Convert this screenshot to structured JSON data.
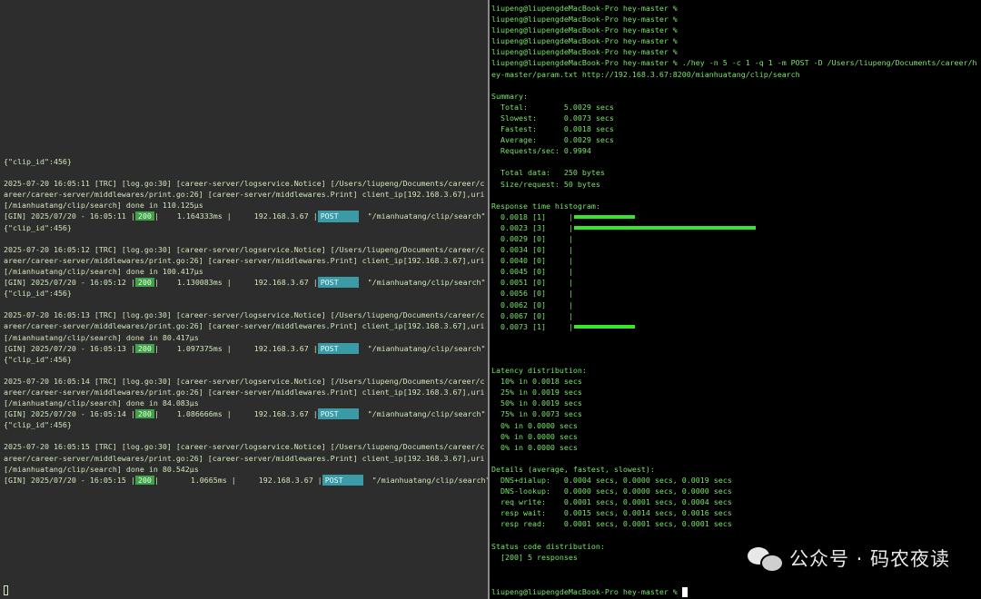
{
  "left_terminal": {
    "first_line": "{\"clip_id\":456}",
    "entries": [
      {
        "log1": "2025-07-20 16:05:11 [TRC] [log.go:30] [career-server/logservice.Notice] [/Users/liupeng/Documents/career/c",
        "log2": "areer/career-server/middlewares/print.go:26] [career-server/middlewares.Print] client_ip[192.168.3.67],uri",
        "log3": "[/mianhuatang/clip/search] done in 110.125µs",
        "gin_prefix": "[GIN] 2025/07/20 - 16:05:11 |",
        "status": "200",
        "mid": "|    1.164333ms |     192.168.3.67 |",
        "method": "POST",
        "path": "  \"/mianhuatang/clip/search\"",
        "body": "{\"clip_id\":456}"
      },
      {
        "log1": "2025-07-20 16:05:12 [TRC] [log.go:30] [career-server/logservice.Notice] [/Users/liupeng/Documents/career/c",
        "log2": "areer/career-server/middlewares/print.go:26] [career-server/middlewares.Print] client_ip[192.168.3.67],uri",
        "log3": "[/mianhuatang/clip/search] done in 100.417µs",
        "gin_prefix": "[GIN] 2025/07/20 - 16:05:12 |",
        "status": "200",
        "mid": "|    1.130083ms |     192.168.3.67 |",
        "method": "POST",
        "path": "  \"/mianhuatang/clip/search\"",
        "body": "{\"clip_id\":456}"
      },
      {
        "log1": "2025-07-20 16:05:13 [TRC] [log.go:30] [career-server/logservice.Notice] [/Users/liupeng/Documents/career/c",
        "log2": "areer/career-server/middlewares/print.go:26] [career-server/middlewares.Print] client_ip[192.168.3.67],uri",
        "log3": "[/mianhuatang/clip/search] done in 80.417µs",
        "gin_prefix": "[GIN] 2025/07/20 - 16:05:13 |",
        "status": "200",
        "mid": "|    1.097375ms |     192.168.3.67 |",
        "method": "POST",
        "path": "  \"/mianhuatang/clip/search\"",
        "body": "{\"clip_id\":456}"
      },
      {
        "log1": "2025-07-20 16:05:14 [TRC] [log.go:30] [career-server/logservice.Notice] [/Users/liupeng/Documents/career/c",
        "log2": "areer/career-server/middlewares/print.go:26] [career-server/middlewares.Print] client_ip[192.168.3.67],uri",
        "log3": "[/mianhuatang/clip/search] done in 84.083µs",
        "gin_prefix": "[GIN] 2025/07/20 - 16:05:14 |",
        "status": "200",
        "mid": "|    1.086666ms |     192.168.3.67 |",
        "method": "POST",
        "path": "  \"/mianhuatang/clip/search\"",
        "body": "{\"clip_id\":456}"
      },
      {
        "log1": "2025-07-20 16:05:15 [TRC] [log.go:30] [career-server/logservice.Notice] [/Users/liupeng/Documents/career/c",
        "log2": "areer/career-server/middlewares/print.go:26] [career-server/middlewares.Print] client_ip[192.168.3.67],uri",
        "log3": "[/mianhuatang/clip/search] done in 80.542µs",
        "gin_prefix": "[GIN] 2025/07/20 - 16:05:15 |",
        "status": "200",
        "mid": "|       1.0665ms |     192.168.3.67 |",
        "method": "POST",
        "path": "  \"/mianhuatang/clip/search\"",
        "body": ""
      }
    ],
    "cursor": ""
  },
  "right_terminal": {
    "prompts": [
      "liupeng@liupengdeMacBook-Pro hey-master %",
      "liupeng@liupengdeMacBook-Pro hey-master %",
      "liupeng@liupengdeMacBook-Pro hey-master %",
      "liupeng@liupengdeMacBook-Pro hey-master %",
      "liupeng@liupengdeMacBook-Pro hey-master %"
    ],
    "command_line1": "liupeng@liupengdeMacBook-Pro hey-master % ./hey -n 5 -c 1 -q 1 -m POST -D /Users/liupeng/Documents/career/h",
    "command_line2": "ey-master/param.txt http://192.168.3.67:8200/mianhuatang/clip/search",
    "summary_title": "Summary:",
    "summary": [
      "  Total:        5.0029 secs",
      "  Slowest:      0.0073 secs",
      "  Fastest:      0.0018 secs",
      "  Average:      0.0029 secs",
      "  Requests/sec: 0.9994"
    ],
    "data_lines": [
      "  Total data:   250 bytes",
      "  Size/request: 50 bytes"
    ],
    "histogram_title": "Response time histogram:",
    "histogram": [
      {
        "label": "  0.0018 [1]     |",
        "count": 1
      },
      {
        "label": "  0.0023 [3]     |",
        "count": 3
      },
      {
        "label": "  0.0029 [0]     |",
        "count": 0
      },
      {
        "label": "  0.0034 [0]     |",
        "count": 0
      },
      {
        "label": "  0.0040 [0]     |",
        "count": 0
      },
      {
        "label": "  0.0045 [0]     |",
        "count": 0
      },
      {
        "label": "  0.0051 [0]     |",
        "count": 0
      },
      {
        "label": "  0.0056 [0]     |",
        "count": 0
      },
      {
        "label": "  0.0062 [0]     |",
        "count": 0
      },
      {
        "label": "  0.0067 [0]     |",
        "count": 0
      },
      {
        "label": "  0.0073 [1]     |",
        "count": 1
      }
    ],
    "latency_title": "Latency distribution:",
    "latency": [
      "  10% in 0.0018 secs",
      "  25% in 0.0019 secs",
      "  50% in 0.0019 secs",
      "  75% in 0.0073 secs",
      "  0% in 0.0000 secs",
      "  0% in 0.0000 secs",
      "  0% in 0.0000 secs"
    ],
    "details_title": "Details (average, fastest, slowest):",
    "details": [
      "  DNS+dialup:   0.0004 secs, 0.0000 secs, 0.0019 secs",
      "  DNS-lookup:   0.0000 secs, 0.0000 secs, 0.0000 secs",
      "  req write:    0.0001 secs, 0.0001 secs, 0.0004 secs",
      "  resp wait:    0.0015 secs, 0.0014 secs, 0.0016 secs",
      "  resp read:    0.0001 secs, 0.0001 secs, 0.0001 secs"
    ],
    "status_title": "Status code distribution:",
    "status_lines": [
      "  [200] 5 responses"
    ],
    "final_prompt": "liupeng@liupengdeMacBook-Pro hey-master % "
  },
  "watermark": {
    "text": "公众号 · 码农夜读",
    "icon": "wechat-icon"
  },
  "colors": {
    "left_bg": "#2d2d2d",
    "left_text": "#cfe7b8",
    "right_bg": "#000000",
    "right_text": "#78e36a",
    "status_badge": "#3fa14a",
    "method_badge": "#3a9aa6",
    "histogram_bar": "#36e62a"
  }
}
